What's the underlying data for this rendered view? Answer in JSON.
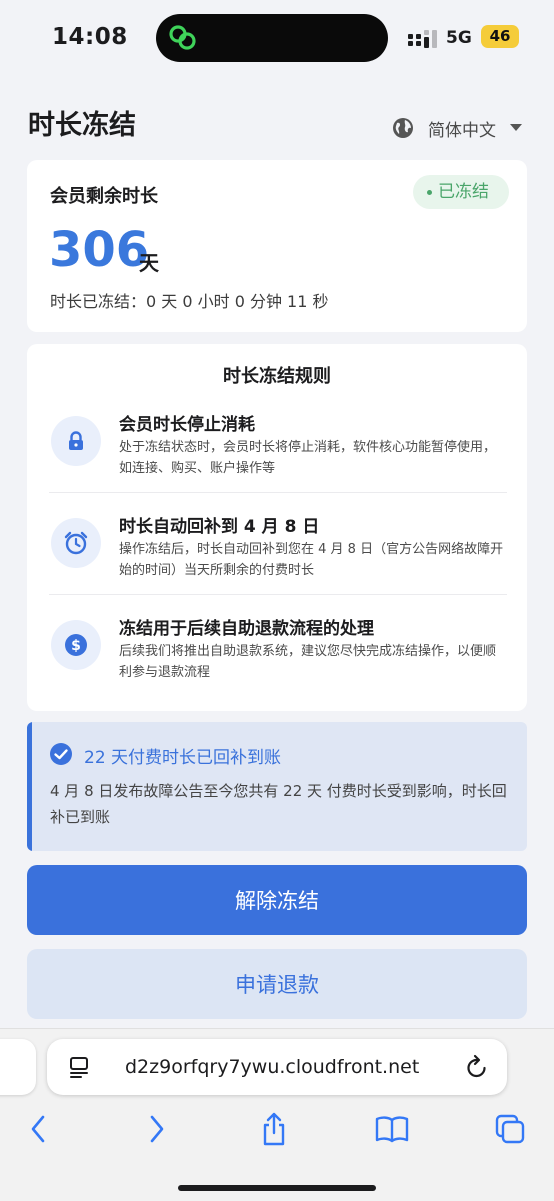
{
  "status_bar": {
    "time": "14:08",
    "network": "5G",
    "battery": "46",
    "island_icon": "link-icon"
  },
  "header": {
    "title": "时长冻结",
    "language": "简体中文",
    "language_icon": "globe-icon"
  },
  "member": {
    "title": "会员剩余时长",
    "status_badge": "已冻结",
    "remaining_days": "306",
    "days_unit": "天",
    "frozen_duration": "时长已冻结：0 天 0 小时 0 分钟 11 秒"
  },
  "rules": {
    "title": "时长冻结规则",
    "items": [
      {
        "icon": "lock-icon",
        "heading": "会员时长停止消耗",
        "description": "处于冻结状态时，会员时长将停止消耗，软件核心功能暂停使用，如连接、购买、账户操作等"
      },
      {
        "icon": "alarm-clock-icon",
        "heading": "时长自动回补到 4 月 8 日",
        "description": "操作冻结后，时长自动回补到您在 4 月 8 日（官方公告网络故障开始的时间）当天所剩余的付费时长"
      },
      {
        "icon": "dollar-icon",
        "heading": "冻结用于后续自助退款流程的处理",
        "description": "后续我们将推出自助退款系统，建议您尽快完成冻结操作，以便顺利参与退款流程"
      }
    ]
  },
  "notice": {
    "icon": "check-circle-icon",
    "title": "22 天付费时长已回补到账",
    "text": "4 月 8 日发布故障公告至今您共有 22 天 付费时长受到影响，时长回补已到账"
  },
  "actions": {
    "unfreeze_label": "解除冻结",
    "refund_label": "申请退款"
  },
  "browser": {
    "url": "d2z9orfqry7ywu.cloudfront.net"
  },
  "colors": {
    "accent": "#3a71dc",
    "success": "#4aa56a",
    "background": "#f2f3f7"
  }
}
